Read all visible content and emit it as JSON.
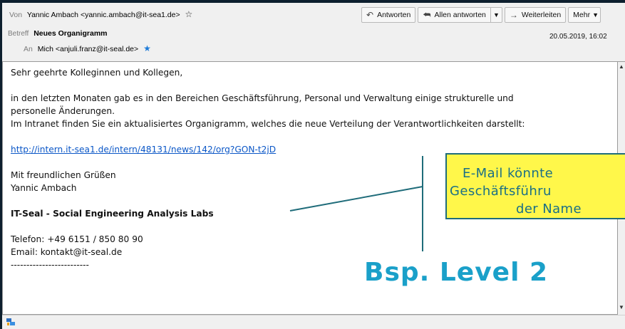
{
  "header": {
    "from_label": "Von",
    "from_value": "Yannic Ambach <yannic.ambach@it-sea1.de>",
    "subject_label": "Betreff",
    "subject_value": "Neues Organigramm",
    "to_label": "An",
    "to_value": "Mich <anjuli.franz@it-seal.de>",
    "date": "20.05.2019, 16:02"
  },
  "toolbar": {
    "reply": "Antworten",
    "reply_all": "Allen antworten",
    "forward": "Weiterleiten",
    "more": "Mehr"
  },
  "body": {
    "greeting": "Sehr geehrte Kolleginnen und Kollegen,",
    "para1_line1": "in den letzten Monaten gab es in den Bereichen Geschäftsführung, Personal und Verwaltung einige strukturelle und",
    "para1_line2": "personelle Änderungen.",
    "para1_line3": "Im Intranet finden Sie ein aktualisiertes Organigramm, welches die neue Verteilung der Verantwortlichkeiten darstellt:",
    "link": "http://intern.it-sea1.de/intern/48131/news/142/org?GON-t2jD",
    "closing": "Mit freundlichen Grüßen",
    "signature_name": "Yannic Ambach",
    "company": "IT-Seal - Social Engineering Analysis Labs",
    "phone": "Telefon: +49 6151 / 850 80 90",
    "email": "Email: kontakt@it-seal.de",
    "separator": "-------------------------"
  },
  "annotation": {
    "callout_line1": "E-Mail könnte",
    "callout_line2": "Geschäftsführu",
    "callout_line3": "der Name",
    "level_label": "Bsp. Level 2"
  },
  "colors": {
    "callout_bg": "#fff74a",
    "callout_text": "#1a6f86",
    "level_label": "#1aa0c9",
    "link": "#0b57c7",
    "star_filled": "#1e7bd8"
  }
}
